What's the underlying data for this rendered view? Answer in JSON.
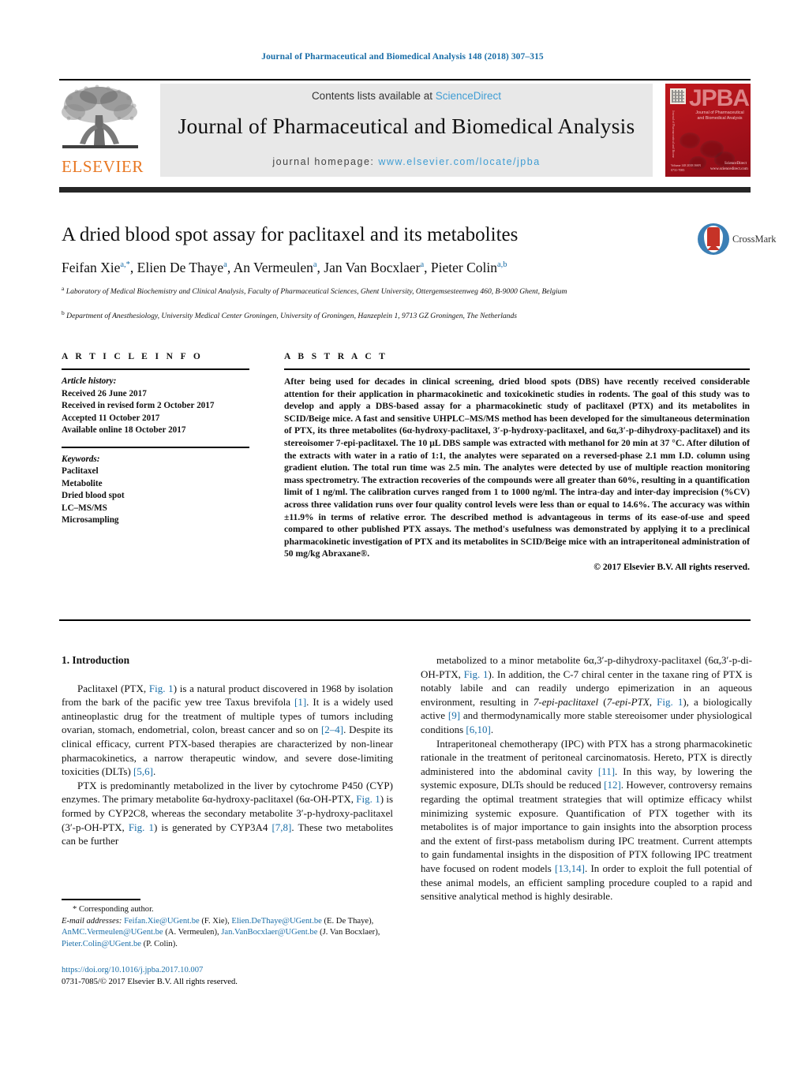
{
  "running_head": "Journal of Pharmaceutical and Biomedical Analysis 148 (2018) 307–315",
  "masthead": {
    "publisher_name": "ELSEVIER",
    "contents_prefix": "Contents lists available at ",
    "sciencedirect": "ScienceDirect",
    "journal_title": "Journal of Pharmaceutical and Biomedical Analysis",
    "homepage_label": "journal homepage:",
    "homepage_url": "www.elsevier.com/locate/jpba",
    "cover": {
      "acronym": "JPBA",
      "subtitle": "Journal of Pharmaceutical and Biomedical Analysis",
      "spine_text": "Journal of Pharmaceutical and Biomedical Analysis",
      "foot_text": "Volume 148  2018  ISSN 0731-7085",
      "brand": "ScienceDirect  www.sciencedirect.com"
    },
    "colors": {
      "link": "#3f9dd4",
      "elsevier_orange": "#E87722",
      "cover_red": "#b01217",
      "runhead_blue": "#1a6ea8"
    }
  },
  "article": {
    "title": "A dried blood spot assay for paclitaxel and its metabolites",
    "authors_html": "Feifan Xie<sup>a,*</sup>, Elien De Thaye<sup>a</sup>, An Vermeulen<sup>a</sup>, Jan Van Bocxlaer<sup>a</sup>, Pieter Colin<sup>a,b</sup>",
    "affiliation_a": "Laboratory of Medical Biochemistry and Clinical Analysis, Faculty of Pharmaceutical Sciences, Ghent University, Ottergemsesteenweg 460, B-9000 Ghent, Belgium",
    "affiliation_b": "Department of Anesthesiology, University Medical Center Groningen, University of Groningen, Hanzeplein 1, 9713 GZ Groningen, The Netherlands",
    "crossmark_label": "CrossMark"
  },
  "article_info": {
    "heading": "A R T I C L E   I N F O",
    "history_label": "Article history:",
    "history": [
      "Received 26 June 2017",
      "Received in revised form 2 October 2017",
      "Accepted 11 October 2017",
      "Available online 18 October 2017"
    ],
    "keywords_label": "Keywords:",
    "keywords": [
      "Paclitaxel",
      "Metabolite",
      "Dried blood spot",
      "LC–MS/MS",
      "Microsampling"
    ]
  },
  "abstract": {
    "heading": "A B S T R A C T",
    "text": "After being used for decades in clinical screening, dried blood spots (DBS) have recently received considerable attention for their application in pharmacokinetic and toxicokinetic studies in rodents. The goal of this study was to develop and apply a DBS-based assay for a pharmacokinetic study of paclitaxel (PTX) and its metabolites in SCID/Beige mice. A fast and sensitive UHPLC–MS/MS method has been developed for the simultaneous determination of PTX, its three metabolites (6α-hydroxy-paclitaxel, 3′-p-hydroxy-paclitaxel, and 6α,3′-p-dihydroxy-paclitaxel) and its stereoisomer 7-epi-paclitaxel. The 10 μL DBS sample was extracted with methanol for 20 min at 37 °C. After dilution of the extracts with water in a ratio of 1:1, the analytes were separated on a reversed-phase 2.1 mm I.D. column using gradient elution. The total run time was 2.5 min. The analytes were detected by use of multiple reaction monitoring mass spectrometry. The extraction recoveries of the compounds were all greater than 60%, resulting in a quantification limit of 1 ng/ml. The calibration curves ranged from 1 to 1000 ng/ml. The intra-day and inter-day imprecision (%CV) across three validation runs over four quality control levels were less than or equal to 14.6%. The accuracy was within ±11.9% in terms of relative error. The described method is advantageous in terms of its ease-of-use and speed compared to other published PTX assays. The method's usefulness was demonstrated by applying it to a preclinical pharmacokinetic investigation of PTX and its metabolites in SCID/Beige mice with an intraperitoneal administration of 50 mg/kg Abraxane®.",
    "copyright": "© 2017 Elsevier B.V. All rights reserved."
  },
  "body": {
    "section_heading": "1. Introduction",
    "left_paragraph_1": "Paclitaxel (PTX, Fig. 1) is a natural product discovered in 1968 by isolation from the bark of the pacific yew tree Taxus brevifola [1]. It is a widely used antineoplastic drug for the treatment of multiple types of tumors including ovarian, stomach, endometrial, colon, breast cancer and so on [2–4]. Despite its clinical efficacy, current PTX-based therapies are characterized by non-linear pharmacokinetics, a narrow therapeutic window, and severe dose-limiting toxicities (DLTs) [5,6].",
    "left_paragraph_2": "PTX is predominantly metabolized in the liver by cytochrome P450 (CYP) enzymes. The primary metabolite 6α-hydroxy-paclitaxel (6α-OH-PTX, Fig. 1) is formed by CYP2C8, whereas the secondary metabolite 3′-p-hydroxy-paclitaxel (3′-p-OH-PTX, Fig. 1) is generated by CYP3A4 [7,8]. These two metabolites can be further",
    "right_paragraph_1": "metabolized to a minor metabolite 6α,3′-p-dihydroxy-paclitaxel (6α,3′-p-di-OH-PTX, Fig. 1). In addition, the C-7 chiral center in the taxane ring of PTX is notably labile and can readily undergo epimerization in an aqueous environment, resulting in 7-epi-paclitaxel (7-epi-PTX, Fig. 1), a biologically active [9] and thermodynamically more stable stereoisomer under physiological conditions [6,10].",
    "right_paragraph_2": "Intraperitoneal chemotherapy (IPC) with PTX has a strong pharmacokinetic rationale in the treatment of peritoneal carcinomatosis. Hereto, PTX is directly administered into the abdominal cavity [11]. In this way, by lowering the systemic exposure, DLTs should be reduced [12]. However, controversy remains regarding the optimal treatment strategies that will optimize efficacy whilst minimizing systemic exposure. Quantification of PTX together with its metabolites is of major importance to gain insights into the absorption process and the extent of first-pass metabolism during IPC treatment. Current attempts to gain fundamental insights in the disposition of PTX following IPC treatment have focused on rodent models [13,14]. In order to exploit the full potential of these animal models, an efficient sampling procedure coupled to a rapid and sensitive analytical method is highly desirable."
  },
  "footnotes": {
    "corresponding": "* Corresponding author.",
    "email_label": "E-mail addresses:",
    "emails": [
      {
        "address": "Feifan.Xie@UGent.be",
        "name": "(F. Xie)"
      },
      {
        "address": "Elien.DeThaye@UGent.be",
        "name": "(E. De Thaye)"
      },
      {
        "address": "AnMC.Vermeulen@UGent.be",
        "name": "(A. Vermeulen)"
      },
      {
        "address": "Jan.VanBocxlaer@UGent.be",
        "name": "(J. Van Bocxlaer)"
      },
      {
        "address": "Pieter.Colin@UGent.be",
        "name": "(P. Colin)"
      }
    ],
    "doi": "https://doi.org/10.1016/j.jpba.2017.10.007",
    "issn_line": "0731-7085/© 2017 Elsevier B.V. All rights reserved."
  }
}
